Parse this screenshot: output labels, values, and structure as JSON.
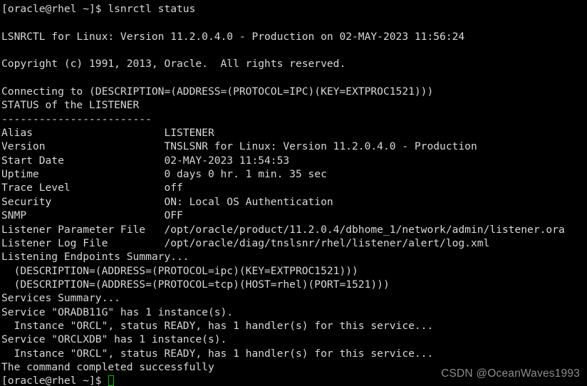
{
  "terminal": {
    "background_color": "#000000",
    "text_color": "#d8d8d8",
    "cursor_color": "#00c400",
    "prompt": "[oracle@rhel ~]$ ",
    "command": "lsnrctl status",
    "lines": [
      "[oracle@rhel ~]$ lsnrctl status",
      "",
      "LSNRCTL for Linux: Version 11.2.0.4.0 - Production on 02-MAY-2023 11:56:24",
      "",
      "Copyright (c) 1991, 2013, Oracle.  All rights reserved.",
      "",
      "Connecting to (DESCRIPTION=(ADDRESS=(PROTOCOL=IPC)(KEY=EXTPROC1521)))",
      "STATUS of the LISTENER",
      "------------------------",
      "Alias                     LISTENER",
      "Version                   TNSLSNR for Linux: Version 11.2.0.4.0 - Production",
      "Start Date                02-MAY-2023 11:54:53",
      "Uptime                    0 days 0 hr. 1 min. 35 sec",
      "Trace Level               off",
      "Security                  ON: Local OS Authentication",
      "SNMP                      OFF",
      "Listener Parameter File   /opt/oracle/product/11.2.0.4/dbhome_1/network/admin/listener.ora",
      "Listener Log File         /opt/oracle/diag/tnslsnr/rhel/listener/alert/log.xml",
      "Listening Endpoints Summary...",
      "  (DESCRIPTION=(ADDRESS=(PROTOCOL=ipc)(KEY=EXTPROC1521)))",
      "  (DESCRIPTION=(ADDRESS=(PROTOCOL=tcp)(HOST=rhel)(PORT=1521)))",
      "Services Summary...",
      "Service \"ORADB11G\" has 1 instance(s).",
      "  Instance \"ORCL\", status READY, has 1 handler(s) for this service...",
      "Service \"ORCLXDB\" has 1 instance(s).",
      "  Instance \"ORCL\", status READY, has 1 handler(s) for this service...",
      "The command completed successfully"
    ],
    "status_fields": [
      {
        "label": "Alias",
        "value": "LISTENER"
      },
      {
        "label": "Version",
        "value": "TNSLSNR for Linux: Version 11.2.0.4.0 - Production"
      },
      {
        "label": "Start Date",
        "value": "02-MAY-2023 11:54:53"
      },
      {
        "label": "Uptime",
        "value": "0 days 0 hr. 1 min. 35 sec"
      },
      {
        "label": "Trace Level",
        "value": "off"
      },
      {
        "label": "Security",
        "value": "ON: Local OS Authentication"
      },
      {
        "label": "SNMP",
        "value": "OFF"
      },
      {
        "label": "Listener Parameter File",
        "value": "/opt/oracle/product/11.2.0.4/dbhome_1/network/admin/listener.ora"
      },
      {
        "label": "Listener Log File",
        "value": "/opt/oracle/diag/tnslsnr/rhel/listener/alert/log.xml"
      }
    ]
  },
  "watermark": {
    "text": "CSDN @OceanWaves1993"
  }
}
